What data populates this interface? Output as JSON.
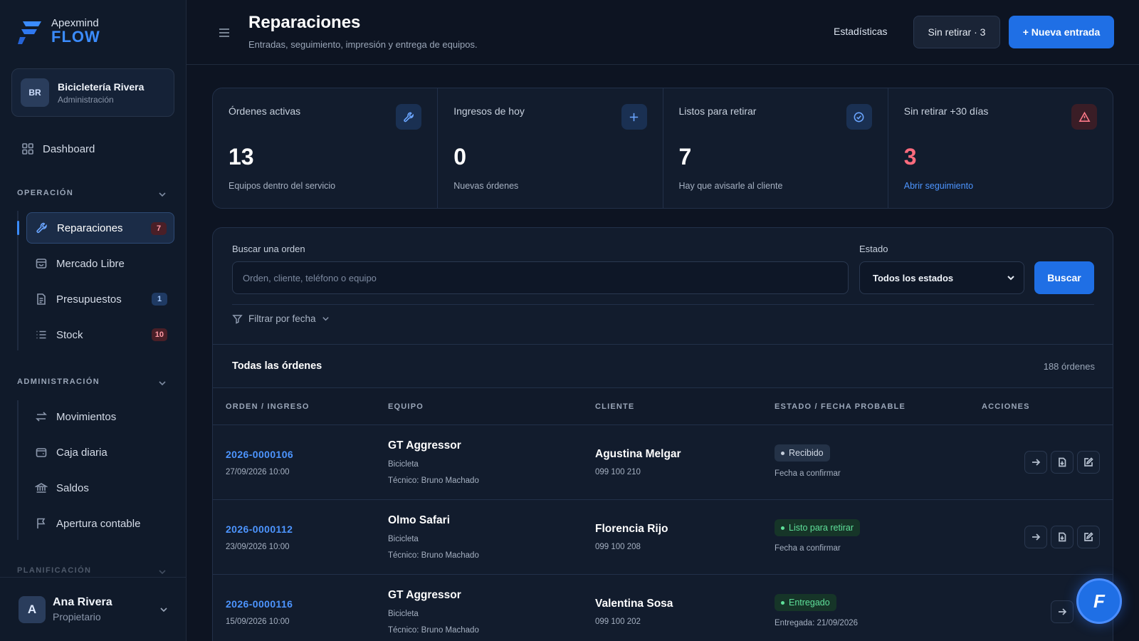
{
  "brand": {
    "line1": "Apexmind",
    "line2": "FLOW"
  },
  "org": {
    "initials": "BR",
    "name": "Bicicletería Rivera",
    "role": "Administración"
  },
  "nav": {
    "dashboard": "Dashboard",
    "operacion": {
      "title": "OPERACIÓN",
      "items": [
        {
          "label": "Reparaciones",
          "badge": "7",
          "icon": "wrench-icon"
        },
        {
          "label": "Mercado Libre",
          "badge": "",
          "icon": "shop-icon"
        },
        {
          "label": "Presupuestos",
          "badge": "1",
          "icon": "document-icon"
        },
        {
          "label": "Stock",
          "badge": "10",
          "icon": "list-icon"
        }
      ]
    },
    "administracion": {
      "title": "ADMINISTRACIÓN",
      "items": [
        {
          "label": "Movimientos",
          "icon": "arrows-icon"
        },
        {
          "label": "Caja diaria",
          "icon": "wallet-icon"
        },
        {
          "label": "Saldos",
          "icon": "bank-icon"
        },
        {
          "label": "Apertura contable",
          "icon": "flag-icon"
        }
      ]
    },
    "planificacion": {
      "title": "PLANIFICACIÓN"
    }
  },
  "user": {
    "initial": "A",
    "name": "Ana Rivera",
    "role": "Propietario"
  },
  "header": {
    "title": "Reparaciones",
    "subtitle": "Entradas, seguimiento, impresión y entrega de equipos.",
    "stats_link": "Estadísticas",
    "pending_button": "Sin retirar · 3",
    "new_button": "+ Nueva entrada"
  },
  "stats": [
    {
      "label": "Órdenes activas",
      "value": "13",
      "note": "Equipos dentro del servicio",
      "icon": "wrench-icon"
    },
    {
      "label": "Ingresos de hoy",
      "value": "0",
      "note": "Nuevas órdenes",
      "icon": "plus-icon"
    },
    {
      "label": "Listos para retirar",
      "value": "7",
      "note": "Hay que avisarle al cliente",
      "icon": "check-circle-icon"
    },
    {
      "label": "Sin retirar +30 días",
      "value": "3",
      "note": "Abrir seguimiento",
      "icon": "warning-icon"
    }
  ],
  "colors": {
    "accent": "#1f6fe5",
    "danger": "#ff6b7d",
    "success": "#5fe09a"
  },
  "search": {
    "label": "Buscar una orden",
    "placeholder": "Orden, cliente, teléfono o equipo",
    "value": "",
    "estado_label": "Estado",
    "estado_value": "Todos los estados",
    "button": "Buscar",
    "filter": "Filtrar por fecha"
  },
  "list": {
    "title": "Todas las órdenes",
    "count": "188 órdenes"
  },
  "table": {
    "headers": [
      "ORDEN / INGRESO",
      "EQUIPO",
      "CLIENTE",
      "ESTADO / FECHA PROBABLE",
      "ACCIONES"
    ],
    "rows": [
      {
        "order": "2026-0000106",
        "date": "27/09/2026 10:00",
        "equipo": "GT Aggressor",
        "tipo": "Bicicleta",
        "tecnico": "Técnico: Bruno Machado",
        "cliente": "Agustina Melgar",
        "telefono": "099 100 210",
        "estado": "Recibido",
        "estado_color": "gray",
        "fecha": "Fecha a confirmar"
      },
      {
        "order": "2026-0000112",
        "date": "23/09/2026 10:00",
        "equipo": "Olmo Safari",
        "tipo": "Bicicleta",
        "tecnico": "Técnico: Bruno Machado",
        "cliente": "Florencia Rijo",
        "telefono": "099 100 208",
        "estado": "Listo para retirar",
        "estado_color": "green",
        "fecha": "Fecha a confirmar"
      },
      {
        "order": "2026-0000116",
        "date": "15/09/2026 10:00",
        "equipo": "GT Aggressor",
        "tipo": "Bicicleta",
        "tecnico": "Técnico: Bruno Machado",
        "cliente": "Valentina Sosa",
        "telefono": "099 100 202",
        "estado": "Entregado",
        "estado_color": "green",
        "fecha": "Entregada: 21/09/2026"
      }
    ]
  },
  "fab": {
    "label": "F"
  }
}
